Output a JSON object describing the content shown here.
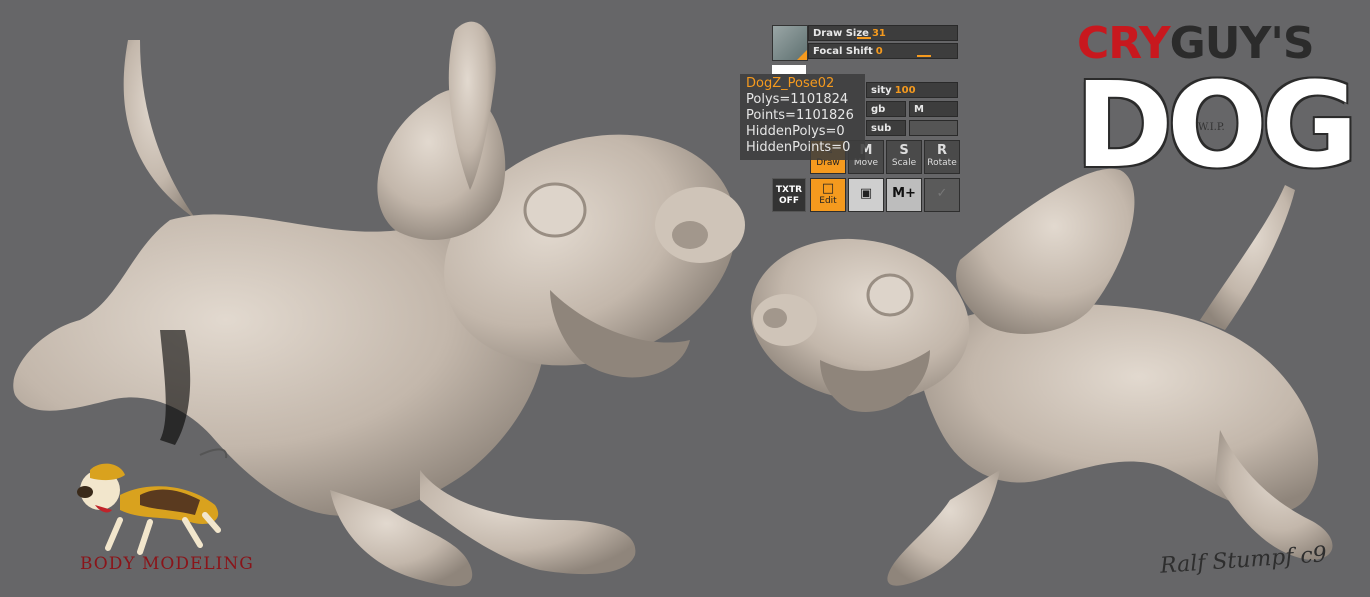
{
  "zbrush": {
    "draw_size_label": "Draw Size",
    "draw_size_value": "31",
    "focal_shift_label": "Focal Shift",
    "focal_shift_value": "0",
    "intensity_label": "sity",
    "intensity_value": "100",
    "rgb_label": "gb",
    "m_label": "M",
    "zsub_label": "sub",
    "info": {
      "tool_name": "DogZ_Pose02",
      "polys": "Polys=1101824",
      "points": "Points=1101826",
      "hidden_polys": "HiddenPolys=0",
      "hidden_points": "HiddenPoints=0"
    },
    "buttons": {
      "draw": "Draw",
      "move": "Move",
      "scale": "Scale",
      "rotate": "Rotate",
      "edit": "Edit",
      "txtr_off": "TXTR OFF",
      "move_key": "M",
      "scale_key": "S",
      "rotate_key": "R",
      "mplus": "M+"
    }
  },
  "logo": {
    "cry": "CRY",
    "guys": "GUY'S",
    "dog": "DOG",
    "wip": "W.I.P."
  },
  "caption": "BODY MODELING",
  "signature": "Ralf Stumpf c9",
  "colors": {
    "background": "#666668",
    "accent": "#f59a1e",
    "logo_red": "#c8181e",
    "caption_red": "#8a1419",
    "clay": "#cdc2b7"
  }
}
